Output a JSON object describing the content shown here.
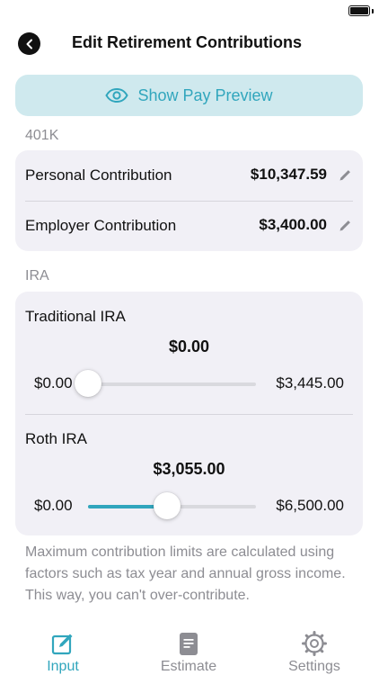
{
  "nav": {
    "title": "Edit Retirement Contributions"
  },
  "preview_button": {
    "label": "Show Pay Preview"
  },
  "k401": {
    "header": "401K",
    "rows": [
      {
        "label": "Personal Contribution",
        "value": "$10,347.59"
      },
      {
        "label": "Employer Contribution",
        "value": "$3,400.00"
      }
    ]
  },
  "ira": {
    "header": "IRA",
    "items": [
      {
        "label": "Traditional IRA",
        "current": "$0.00",
        "min": "$0.00",
        "max": "$3,445.00",
        "fraction": 0.0
      },
      {
        "label": "Roth IRA",
        "current": "$3,055.00",
        "min": "$0.00",
        "max": "$6,500.00",
        "fraction": 0.47
      }
    ]
  },
  "footnote": "Maximum contribution limits are calculated using factors such as tax year and annual gross income. This way, you can't over-contribute.",
  "tabs": [
    {
      "label": "Input",
      "active": true
    },
    {
      "label": "Estimate",
      "active": false
    },
    {
      "label": "Settings",
      "active": false
    }
  ],
  "colors": {
    "accent": "#31a6bd",
    "card": "#f1f0f6",
    "preview_bg": "#cfe9ee",
    "muted": "#8d8d93"
  }
}
